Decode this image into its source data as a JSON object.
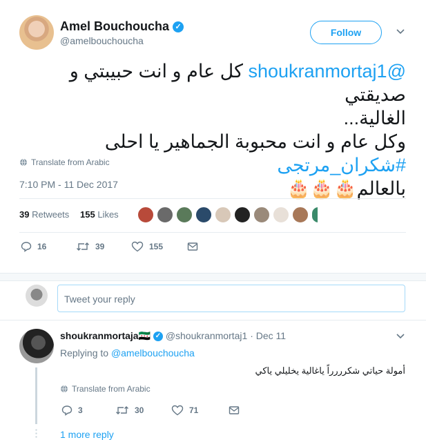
{
  "tweet": {
    "author_name": "Amel Bouchoucha",
    "author_handle": "@amelbouchoucha",
    "follow_label": "Follow",
    "text_mention": "@shoukranmortaj1",
    "text_line1": " كل عام و انت حبيبتي و صديقتي",
    "text_line2": "الغالية...",
    "text_line3_pre": "وكل عام و انت محبوبة الجماهير يا احلى ",
    "text_hashtag": "#شكران_مرتجى",
    "text_line4": "بالعالم",
    "cake_emoji": "🎂🎂🎂",
    "translate_label": "Translate from Arabic",
    "timestamp": "7:10 PM - 11 Dec 2017",
    "retweets_count": "39",
    "retweets_label": "Retweets",
    "likes_count": "155",
    "likes_label": "Likes",
    "actions": {
      "replies": "16",
      "retweets": "39",
      "likes": "155"
    }
  },
  "reply_composer": {
    "placeholder": "Tweet your reply"
  },
  "reply": {
    "author_name": "shoukranmortaja",
    "flag": "🇸🇾",
    "author_handle": "@shoukranmortaj1",
    "dot": "·",
    "date": "Dec 11",
    "replying_to_label": "Replying to",
    "replying_to_handle": "@amelbouchoucha",
    "text": "أمولة حياتي شكرررراً ياغالية يخليلي ياكي",
    "translate_label": "Translate from Arabic",
    "actions": {
      "replies": "3",
      "retweets": "30",
      "likes": "71"
    }
  },
  "more_replies_label": "1 more reply",
  "colors": {
    "accent": "#1da1f2",
    "muted": "#657786",
    "text": "#14171a",
    "divider": "#e6ecf0"
  },
  "icons": [
    "verified-icon",
    "chevron-down-icon",
    "globe-icon",
    "reply-icon",
    "retweet-icon",
    "like-icon",
    "dm-icon"
  ]
}
